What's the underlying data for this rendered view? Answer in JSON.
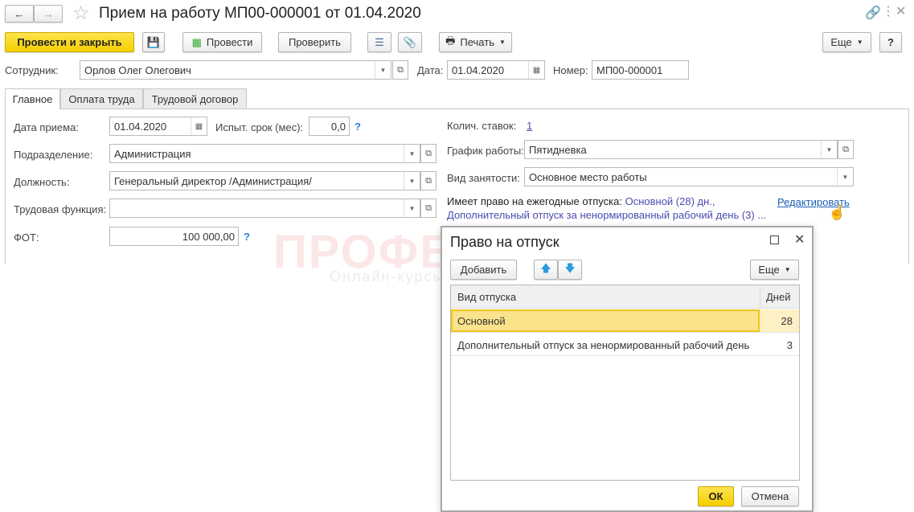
{
  "header": {
    "title": "Прием на работу МП00-000001 от 01.04.2020"
  },
  "toolbar": {
    "post_close": "Провести и закрыть",
    "post": "Провести",
    "check": "Проверить",
    "print": "Печать",
    "more": "Еще",
    "help": "?"
  },
  "employee": {
    "label": "Сотрудник:",
    "value": "Орлов Олег Олегович"
  },
  "date": {
    "label": "Дата:",
    "value": "01.04.2020"
  },
  "number": {
    "label": "Номер:",
    "value": "МП00-000001"
  },
  "tabs": [
    "Главное",
    "Оплата труда",
    "Трудовой договор"
  ],
  "main": {
    "hire_date": {
      "label": "Дата приема:",
      "value": "01.04.2020"
    },
    "probation": {
      "label": "Испыт. срок (мес):",
      "value": "0,0"
    },
    "department": {
      "label": "Подразделение:",
      "value": "Администрация"
    },
    "position": {
      "label": "Должность:",
      "value": "Генеральный директор /Администрация/"
    },
    "labor_function": {
      "label": "Трудовая функция:",
      "value": ""
    },
    "fot": {
      "label": "ФОТ:",
      "value": "100 000,00"
    },
    "rates": {
      "label": "Колич. ставок:",
      "value": "1"
    },
    "schedule": {
      "label": "График работы:",
      "value": "Пятидневка"
    },
    "employment": {
      "label": "Вид занятости:",
      "value": "Основное место работы"
    },
    "vacation": {
      "label": "Имеет право на ежегодные отпуска:",
      "line1": "Основной (28) дн.,",
      "line2": "Дополнительный отпуск за ненормированный рабочий день (3) ...",
      "edit": "Редактировать"
    }
  },
  "watermark": {
    "brand": "ПРОФБУХ8.ru",
    "tagline": "Онлайн-курсы по работе в 1С:8"
  },
  "dialog": {
    "title": "Право на отпуск",
    "add": "Добавить",
    "more": "Еще",
    "col_type": "Вид отпуска",
    "col_days": "Дней",
    "rows": [
      {
        "type": "Основной",
        "days": "28"
      },
      {
        "type": "Дополнительный отпуск за ненормированный рабочий день",
        "days": "3"
      }
    ],
    "ok": "ОК",
    "cancel": "Отмена"
  }
}
